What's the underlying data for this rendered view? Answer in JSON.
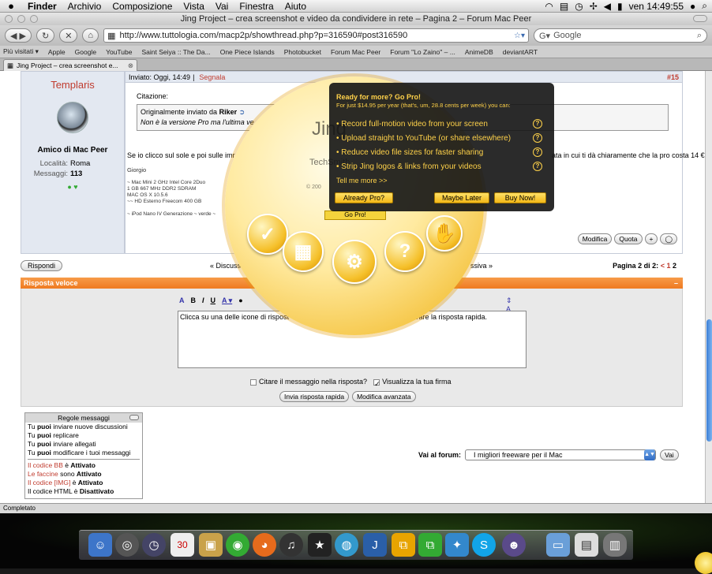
{
  "menubar": {
    "items": [
      "Finder",
      "Archivio",
      "Composizione",
      "Vista",
      "Vai",
      "Finestra",
      "Aiuto"
    ],
    "clock": "ven 14:49:55"
  },
  "window": {
    "title": "Jing Project – crea screenshot e video da condividere in rete – Pagina 2 – Forum Mac Peer"
  },
  "navbar": {
    "url": "http://www.tuttologia.com/macp2p/showthread.php?p=316590#post316590",
    "search_placeholder": "Google"
  },
  "bookmarks": [
    "Più visitati ▾",
    "Apple",
    "Google",
    "YouTube",
    "Saint Seiya :: The Da...",
    "One Piece Islands",
    "Photobucket",
    "Forum Mac Peer",
    "Forum \"Lo Zaino\" – ...",
    "AnimeDB",
    "deviantART"
  ],
  "tab": {
    "label": "Jing Project – crea screenshot e..."
  },
  "post": {
    "username": "Templaris",
    "user_title": "Amico di Mac Peer",
    "location_label": "Località:",
    "location": "Roma",
    "messages_label": "Messaggi:",
    "messages": "113",
    "sent": "Inviato: Oggi, 14:49",
    "report": "Segnala",
    "number": "#15",
    "quote_label": "Citazione:",
    "quote_author_prefix": "Originalmente inviato da",
    "quote_author": "Riker",
    "quote_text": "Non è la versione Pro ma l'ultima ve",
    "body_left": "Se io clicco sul sole e poi sulle imr",
    "body_right": "ata in cui ti dà chiaramente che la pro costa 14 € o.o'",
    "sig_name": "Giorgio",
    "sig_lines": [
      "~ Mac Mini 2 GHz Intel Core 2Duo",
      "1 GB 667 MHz DDR2 SDRAM",
      "MAC OS X 10.5.6",
      "~~ HD Esterno Freecom 400 GB",
      "",
      "~ iPod Nano IV Generazione ~ verde ~"
    ],
    "edit_btn": "Modifica",
    "quote_btn": "Quota"
  },
  "nav": {
    "reply": "Rispondi",
    "prev": "« Discuss",
    "next": "ssiva »",
    "page_label": "Pagina 2 di 2:",
    "page_prev": "< 1",
    "page_cur": "2"
  },
  "quick_reply": {
    "header": "Risposta veloce",
    "collapse": "–",
    "toolbar": "B  I  U  A",
    "textarea_left": "Clicca su una delle icone di rispost",
    "textarea_right": "ivare la risposta rapida.",
    "quote_opt": "Citare il messaggio nella risposta?",
    "sig_opt": "Visualizza la tua firma",
    "send_btn": "Invia risposta rapida",
    "advanced_btn": "Modifica avanzata"
  },
  "rules": {
    "title": "Regole messaggi",
    "lines": [
      {
        "pre": "Tu ",
        "b": "puoi",
        "post": " inviare nuove discussioni"
      },
      {
        "pre": "Tu ",
        "b": "puoi",
        "post": " replicare"
      },
      {
        "pre": "Tu ",
        "b": "puoi",
        "post": " inviare allegati"
      },
      {
        "pre": "Tu ",
        "b": "puoi",
        "post": " modificare i tuoi messaggi"
      }
    ],
    "codes": [
      {
        "red": "Il codice BB",
        "post": " è ",
        "b": "Attivato"
      },
      {
        "red": "Le faccine",
        "post": " sono ",
        "b": "Attivato"
      },
      {
        "red": "Il codice [IMG]",
        "post": " è ",
        "b": "Attivato"
      },
      {
        "red": "Il codice HTML",
        "post": " è ",
        "b": "Disattivato"
      }
    ]
  },
  "forumjump": {
    "label": "Vai al forum:",
    "selected": "I migliori freeware per il Mac",
    "go": "Vai"
  },
  "status": "Completato",
  "jing": {
    "logo": "Jing",
    "brand": "TechSmith",
    "copyright": "© 200",
    "gopro": "Go Pro!"
  },
  "popup": {
    "title": "Ready for more? Go Pro!",
    "subtitle": "For just $14.95 per year (that's, um, 28.8 cents per week) you can:",
    "features": [
      "• Record full-motion video from your screen",
      "• Upload straight to YouTube (or share elsewhere)",
      "• Reduce video file sizes for faster sharing",
      "• Strip Jing logos & links from your videos"
    ],
    "more": "Tell me more >>",
    "btn_already": "Already Pro?",
    "btn_later": "Maybe Later",
    "btn_buy": "Buy Now!"
  }
}
